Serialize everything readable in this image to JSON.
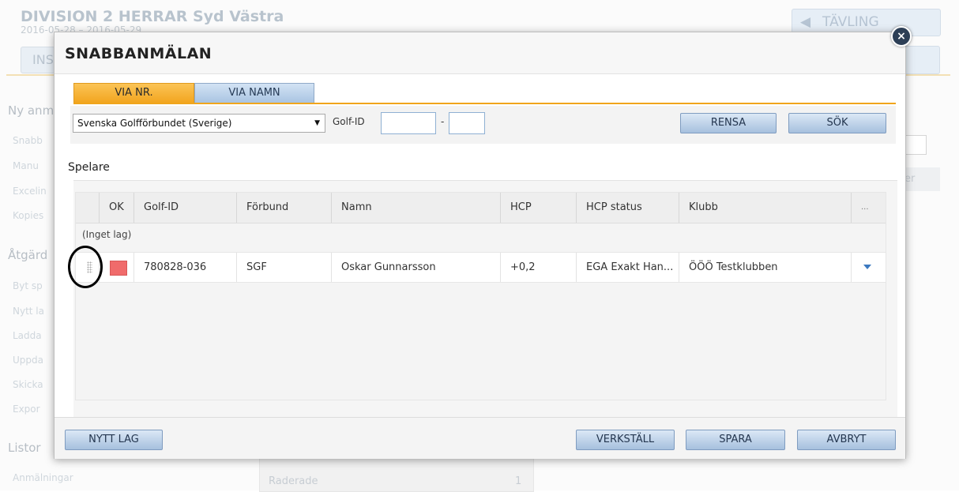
{
  "background": {
    "title": "DIVISION 2 HERRAR Syd Västra",
    "date_range": "2016-05-28 – 2016-05-29",
    "tab_partial": "INS",
    "tavling_button": "TÄVLING",
    "sidebar": {
      "section_ny": "Ny anm",
      "items_ny": [
        "Snabb",
        "Manu",
        "Excelin",
        "Kopies"
      ],
      "section_atgard": "Åtgärd",
      "items_atgard": [
        "Byt sp",
        "Nytt la",
        "Ladda",
        "Uppda",
        "Skicka",
        "Expor"
      ],
      "section_listor": "Listor",
      "anmalningar": "Anmälningar"
    },
    "table": {
      "raderade_label": "Raderade",
      "raderade_value": "1"
    },
    "right_header": "er"
  },
  "modal": {
    "title": "SNABBANMÄLAN",
    "close_symbol": "×",
    "tabs": [
      {
        "label": "VIA NR.",
        "active": true
      },
      {
        "label": "VIA NAMN",
        "active": false
      }
    ],
    "search": {
      "federation_selected": "Svenska Golfförbundet (Sverige)",
      "golf_id_label": "Golf-ID",
      "golf_id_part1": "",
      "golf_id_separator": "-",
      "golf_id_part2": "",
      "rensa_label": "RENSA",
      "sok_label": "SÖK"
    },
    "players_section_label": "Spelare",
    "grid": {
      "columns": [
        "",
        "OK",
        "Golf-ID",
        "Förbund",
        "Namn",
        "HCP",
        "HCP status",
        "Klubb",
        "..."
      ],
      "group_label": "(Inget lag)",
      "rows": [
        {
          "ok_status_color": "#f06b6b",
          "golf_id": "780828-036",
          "forbund": "SGF",
          "namn": "Oskar Gunnarsson",
          "hcp": "+0,2",
          "hcp_status": "EGA Exakt Han...",
          "klubb": "ÖÖÖ Testklubben"
        }
      ]
    },
    "footer": {
      "nytt_lag_label": "NYTT LAG",
      "verkstall_label": "VERKSTÄLL",
      "spara_label": "SPARA",
      "avbryt_label": "AVBRYT"
    }
  }
}
